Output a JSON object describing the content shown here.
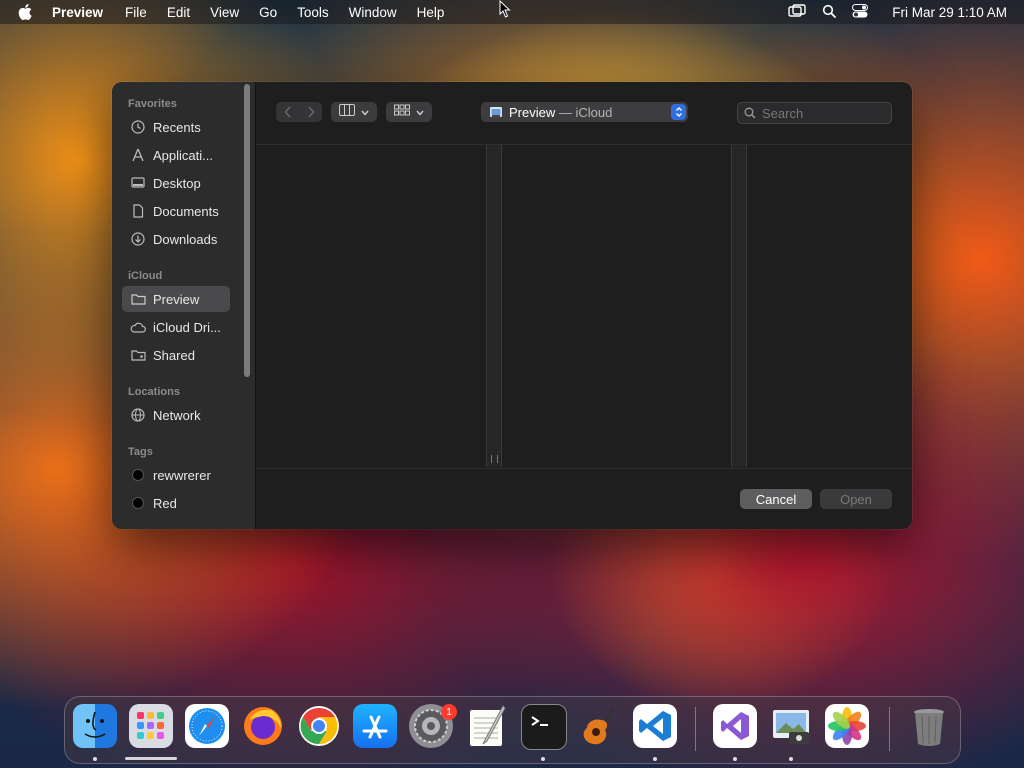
{
  "menubar": {
    "app_name": "Preview",
    "menus": [
      "File",
      "Edit",
      "View",
      "Go",
      "Tools",
      "Window",
      "Help"
    ],
    "clock": "Fri Mar 29  1:10 AM"
  },
  "dialog": {
    "sidebar": {
      "favorites_header": "Favorites",
      "favorites": [
        "Recents",
        "Applicati...",
        "Desktop",
        "Documents",
        "Downloads"
      ],
      "icloud_header": "iCloud",
      "icloud": [
        "Preview",
        "iCloud Dri...",
        "Shared"
      ],
      "selected": "Preview",
      "locations_header": "Locations",
      "locations": [
        "Network"
      ],
      "tags_header": "Tags",
      "tags": [
        "rewwrerer",
        "Red"
      ]
    },
    "toolbar": {
      "location_name": "Preview",
      "location_separator": "—",
      "location_suffix": "iCloud",
      "search_placeholder": "Search"
    },
    "buttons": {
      "cancel": "Cancel",
      "open": "Open"
    }
  },
  "dock": {
    "apps": [
      "Finder",
      "Launchpad",
      "Safari",
      "Firefox",
      "Chrome",
      "App Store",
      "System Preferences",
      "TextEdit",
      "Terminal",
      "GarageBand",
      "Visual Studio Code",
      "Visual Studio",
      "Preview",
      "Photos",
      "Trash"
    ],
    "system_prefs_badge": "1"
  },
  "colors": {
    "accent": "#2f6fe3",
    "badge": "#ff3b30",
    "dialog_bg": "#1e1e1e",
    "sidebar_bg": "#2c2c2d"
  }
}
